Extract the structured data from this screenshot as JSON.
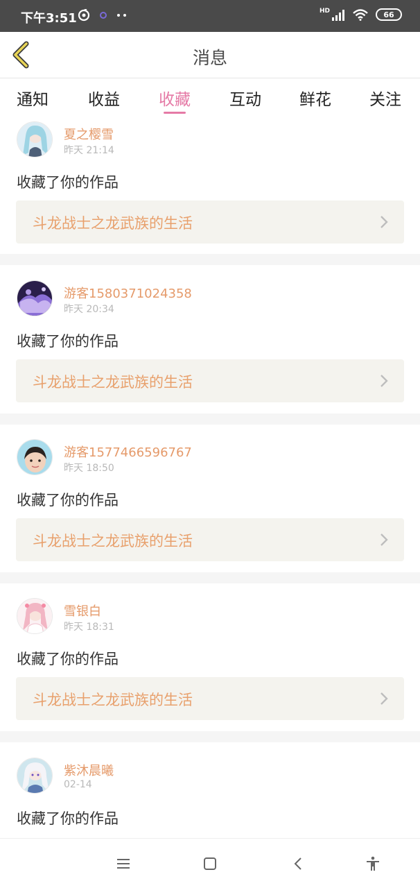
{
  "status_bar": {
    "time": "下午3:51",
    "hd_label": "HD",
    "battery": "66"
  },
  "header": {
    "title": "消息"
  },
  "tabs": [
    {
      "label": "通知",
      "active": false
    },
    {
      "label": "收益",
      "active": false
    },
    {
      "label": "收藏",
      "active": true
    },
    {
      "label": "互动",
      "active": false
    },
    {
      "label": "鲜花",
      "active": false
    },
    {
      "label": "关注",
      "active": false
    }
  ],
  "items": [
    {
      "username": "夏之樱雪",
      "time": "昨天 21:14",
      "action": "收藏了你的作品",
      "work_title": "斗龙战士之龙武族的生活"
    },
    {
      "username": "游客1580371024358",
      "time": "昨天 20:34",
      "action": "收藏了你的作品",
      "work_title": "斗龙战士之龙武族的生活"
    },
    {
      "username": "游客1577466596767",
      "time": "昨天 18:50",
      "action": "收藏了你的作品",
      "work_title": "斗龙战士之龙武族的生活"
    },
    {
      "username": "雪银白",
      "time": "昨天 18:31",
      "action": "收藏了你的作品",
      "work_title": "斗龙战士之龙武族的生活"
    },
    {
      "username": "紫沐晨曦",
      "time": "02-14",
      "action": "收藏了你的作品"
    }
  ],
  "colors": {
    "accent": "#e57aa6",
    "username": "#e59a6a",
    "work_title": "#e8a06c",
    "work_bg": "#f4f3ee",
    "status_bg": "#4a4a4a"
  },
  "icons": {
    "back": "chevron-left-icon",
    "work_arrow": "chevron-right-icon",
    "menu": "menu-icon",
    "home": "home-square-icon",
    "back_sys": "back-icon",
    "accessibility": "accessibility-icon"
  }
}
